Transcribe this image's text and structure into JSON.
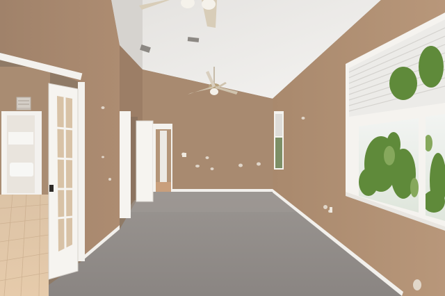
{
  "scene": {
    "subject": "empty room",
    "colors": {
      "wall_light": "#b08f73",
      "wall_mid": "#a4846a",
      "wall_dark": "#9a7b62",
      "ceiling": "#ecebe9",
      "ceiling_shade": "#d9d7d4",
      "carpet": "#8f8a87",
      "carpet_light": "#a29d99",
      "tile": "#e3c7a7",
      "trim": "#f5f3ef",
      "foliage": "#5f8a3a"
    }
  }
}
